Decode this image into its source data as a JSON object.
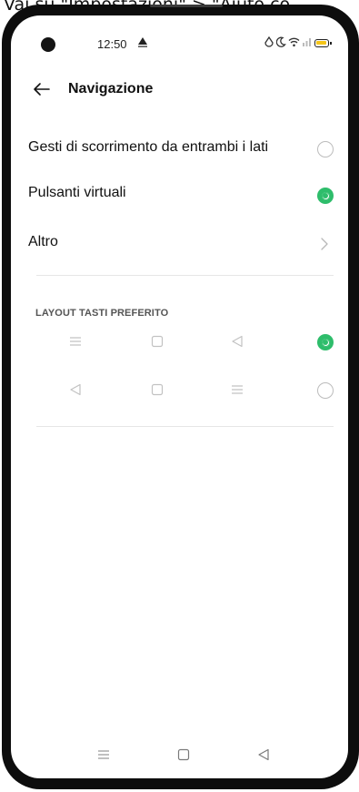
{
  "caption": "Vai su \"Impostazioni\" > \"Aiuto co",
  "status": {
    "time": "12:50",
    "icons": [
      "alert-triangle-icon",
      "drop-icon",
      "moon-icon",
      "wifi-icon",
      "signal-icon",
      "battery-icon"
    ],
    "battery_color": "#f5c518"
  },
  "header": {
    "title": "Navigazione",
    "back_icon": "arrow-left-icon"
  },
  "options": [
    {
      "label": "Gesti di scorrimento da entrambi i lati",
      "selected": false
    },
    {
      "label": "Pulsanti virtuali",
      "selected": true
    },
    {
      "label": "Altro",
      "control": "chevron"
    }
  ],
  "layout_section": {
    "title": "LAYOUT TASTI PREFERITO",
    "rows": [
      {
        "buttons": [
          "menu-icon",
          "square-icon",
          "back-triangle-icon"
        ],
        "selected": true
      },
      {
        "buttons": [
          "back-triangle-icon",
          "square-icon",
          "menu-icon"
        ],
        "selected": false
      }
    ]
  },
  "nav_bar": {
    "buttons": [
      "menu-icon",
      "square-icon",
      "back-triangle-icon"
    ]
  },
  "colors": {
    "accent": "#2ebd6b",
    "text": "#111111",
    "muted": "#bcbcbc"
  }
}
